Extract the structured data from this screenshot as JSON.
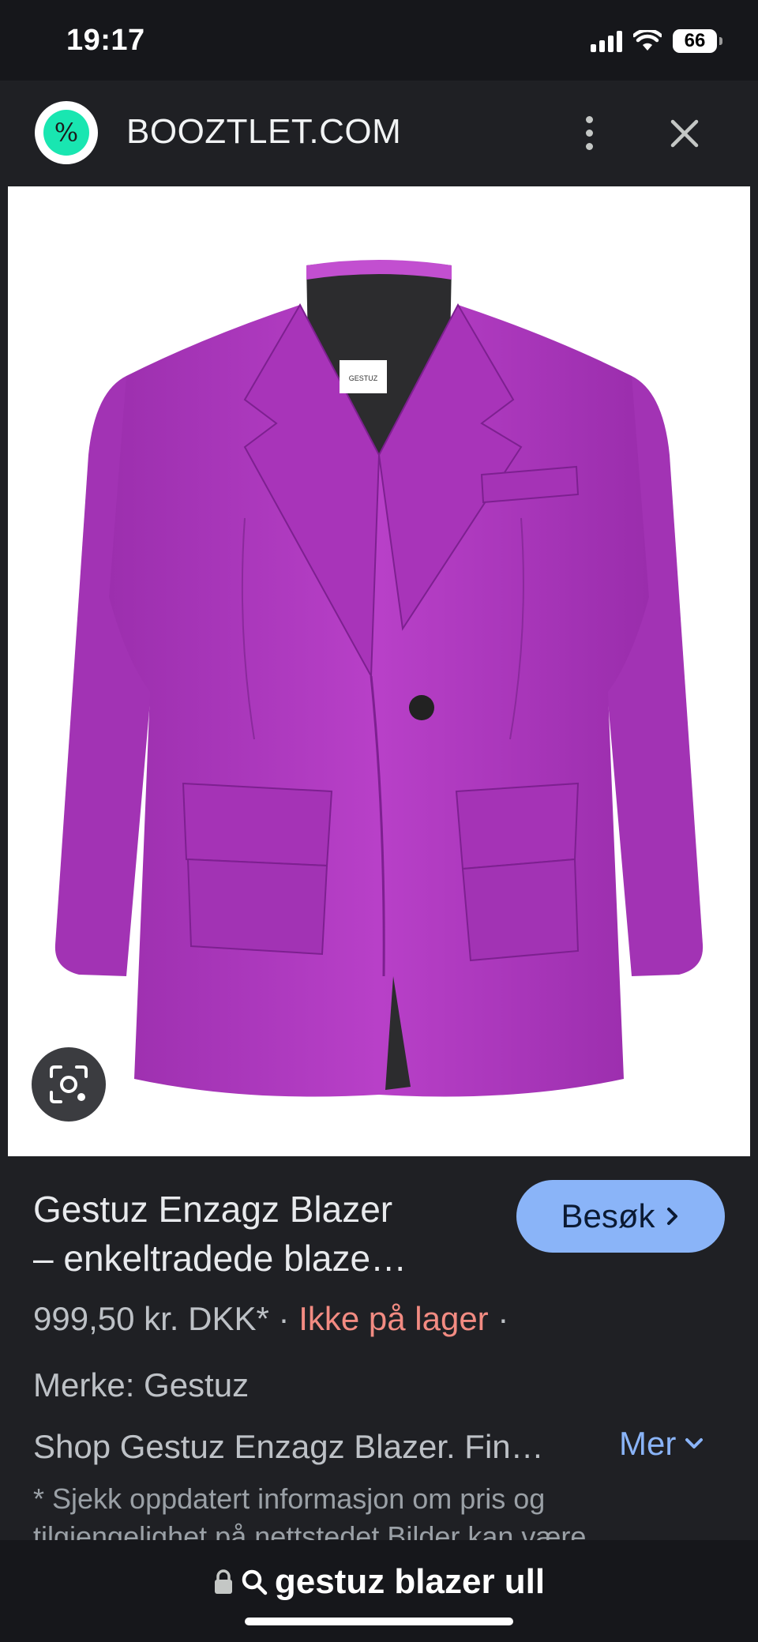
{
  "status_bar": {
    "time": "19:17",
    "battery": "66"
  },
  "header": {
    "site_name": "BOOZTLET.COM",
    "logo_glyph": "%"
  },
  "product": {
    "title_line1": "Gestuz Enzagz Blazer",
    "title_line2": "– enkeltradede blaze…",
    "visit_label": "Besøk",
    "price": "999,50 kr. DKK*",
    "sep1": "·",
    "stock": "Ikke på lager",
    "sep2": "·",
    "brand": "Merke: Gestuz",
    "description": "Shop Gestuz Enzagz Blazer. Fin…",
    "more_label": "Mer",
    "disclaimer_line1": "* Sjekk oppdatert informasjon om pris og",
    "disclaimer_line2": "tilgjengelighet på nettstedet Bilder kan være"
  },
  "image": {
    "garment_color": "#b13dc0",
    "label_text": "GESTUZ"
  },
  "bottom_bar": {
    "query": "gestuz blazer ull"
  },
  "colors": {
    "accent": "#8ab4f8",
    "out_of_stock": "#f28b82",
    "background": "#1f2024"
  }
}
